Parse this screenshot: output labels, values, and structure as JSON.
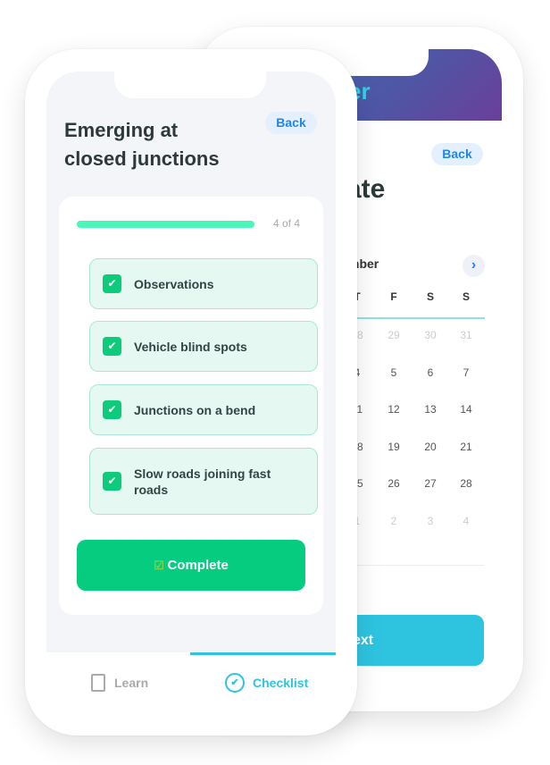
{
  "back_phone": {
    "header_text": "er",
    "back_label": "Back",
    "title": "ate",
    "month": "mber",
    "next_month_icon": "chevron-right-icon",
    "weekdays": [
      "T",
      "F",
      "S",
      "S"
    ],
    "weeks": [
      [
        "28",
        "29",
        "30",
        "31"
      ],
      [
        "4",
        "5",
        "6",
        "7"
      ],
      [
        "11",
        "12",
        "13",
        "14"
      ],
      [
        "18",
        "19",
        "20",
        "21"
      ],
      [
        "25",
        "26",
        "27",
        "28"
      ],
      [
        "1",
        "2",
        "3",
        "4"
      ]
    ],
    "next_label": "ext"
  },
  "front_phone": {
    "title_line1": "Emerging at",
    "title_line2": "closed junctions",
    "back_label": "Back",
    "progress": {
      "value": 1.0,
      "label": "4 of 4"
    },
    "items": [
      {
        "label": "Observations",
        "checked": true
      },
      {
        "label": "Vehicle blind spots",
        "checked": true
      },
      {
        "label": "Junctions on a bend",
        "checked": true
      },
      {
        "label": "Slow roads joining fast roads",
        "checked": true
      }
    ],
    "complete_label": "Complete",
    "tabs": [
      {
        "label": "Learn",
        "icon": "book-icon",
        "active": false
      },
      {
        "label": "Checklist",
        "icon": "badge-check-icon",
        "active": true
      }
    ]
  },
  "colors": {
    "green": "#05cc7e",
    "progress": "#4cf5b8",
    "cyan": "#2ec4e0",
    "blue": "#1f86e8"
  }
}
